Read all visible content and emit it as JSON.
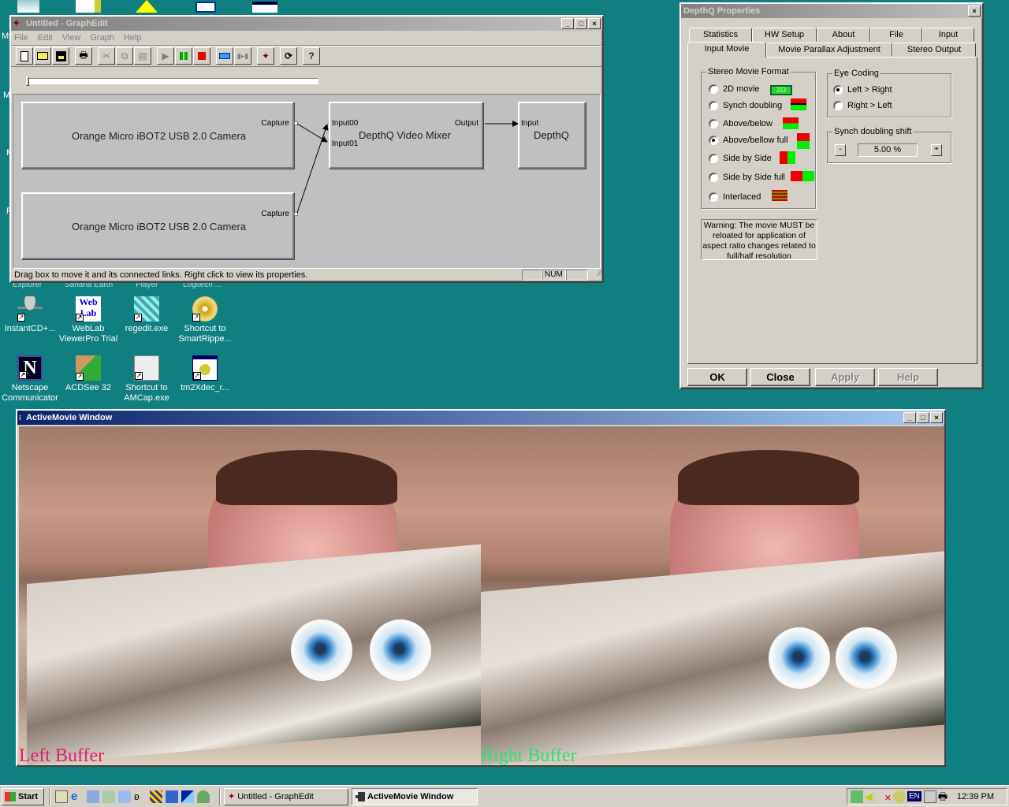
{
  "desktop": {
    "background_color": "#0f7f7f",
    "partial_labels": [
      "My",
      "M",
      "M",
      "R"
    ],
    "hidden_icon_labels": [
      "Explorer",
      "Sanaria Earth",
      "Player",
      "Logitech ..."
    ],
    "icons": [
      {
        "label": "InstantCD+...",
        "icon": "cd-tornado-icon"
      },
      {
        "label": "WebLab ViewerPro Trial",
        "icon": "weblab-icon"
      },
      {
        "label": "regedit.exe",
        "icon": "regedit-icon"
      },
      {
        "label": "Shortcut to SmartRippe...",
        "icon": "cd-disc-icon"
      },
      {
        "label": "Netscape Communicator",
        "icon": "netscape-icon"
      },
      {
        "label": "ACDSee 32",
        "icon": "acdsee-icon"
      },
      {
        "label": "Shortcut to AMCap.exe",
        "icon": "amcap-icon"
      },
      {
        "label": "tm2Xdec_r...",
        "icon": "tm2xdec-icon"
      }
    ]
  },
  "graphedit": {
    "title": "Untitled - GraphEdit",
    "menu": [
      "File",
      "Edit",
      "View",
      "Graph",
      "Help"
    ],
    "toolbar": [
      "new-file",
      "open-file",
      "save-file",
      "print",
      "cut",
      "copy",
      "paste",
      "play",
      "pause",
      "stop",
      "seek",
      "frame-step",
      "graphedit-logo",
      "refresh",
      "help"
    ],
    "filters": [
      {
        "name": "Orange Micro iBOT2 USB 2.0 Camera",
        "pins_out": [
          "Capture"
        ]
      },
      {
        "name": "Orange Micro iBOT2 USB 2.0 Camera",
        "pins_out": [
          "Capture"
        ]
      },
      {
        "name": "DepthQ Video Mixer",
        "pins_in": [
          "Input00",
          "Input01"
        ],
        "pins_out": [
          "Output"
        ]
      },
      {
        "name": "DepthQ",
        "pins_in": [
          "Input"
        ]
      }
    ],
    "status_text": "Drag box to move it and its connected links. Right click to view its properties.",
    "status_num": "NUM"
  },
  "depthq": {
    "title": "DepthQ Properties",
    "tabs_row1": [
      "Statistics",
      "HW Setup",
      "About",
      "File",
      "Input"
    ],
    "tabs_row2": [
      "Input Movie",
      "Movie Parallax Adjustment",
      "Stereo Output"
    ],
    "active_tab": "Input Movie",
    "stereo_format": {
      "label": "Stereo Movie Format",
      "options": [
        {
          "label": "2D movie",
          "checked": false
        },
        {
          "label": "Synch doubling",
          "checked": false
        },
        {
          "label": "Above/below",
          "checked": false
        },
        {
          "label": "Above/bellow full",
          "checked": true
        },
        {
          "label": "Side by Side",
          "checked": false
        },
        {
          "label": "Side by Side full",
          "checked": false
        },
        {
          "label": "Interlaced",
          "checked": false
        }
      ],
      "badge_2d": "2D"
    },
    "eye_coding": {
      "label": "Eye Coding",
      "options": [
        {
          "label": "Left > Right",
          "checked": true
        },
        {
          "label": "Right > Left",
          "checked": false
        }
      ]
    },
    "synch_shift": {
      "label": "Synch doubling shift",
      "minus": "-",
      "plus": "+",
      "value": "5.00 %"
    },
    "warning": "Warning: The movie MUST be reloated for application of aspect ratio changes related to full/half resolution",
    "buttons": {
      "ok": "OK",
      "close": "Close",
      "apply": "Apply",
      "help": "Help"
    },
    "colors": {
      "red": "#ff0000",
      "green": "#00ff00",
      "dark_red": "#c00000"
    }
  },
  "activemovie": {
    "title": "ActiveMovie Window",
    "left_label": "Left Buffer",
    "right_label": "Right Buffer",
    "left_label_color": "#e0206a",
    "right_label_color": "#30e070"
  },
  "taskbar": {
    "start": "Start",
    "quicklaunch": [
      "show-desktop",
      "internet-explorer",
      "outlook",
      "network",
      "media",
      "messenger",
      "app1",
      "app2",
      "app3",
      "app4"
    ],
    "tasks": [
      {
        "label": "Untitled - GraphEdit",
        "active": false
      },
      {
        "label": "ActiveMovie Window",
        "active": true
      }
    ],
    "tray_lang": "EN",
    "clock": "12:39 PM"
  }
}
